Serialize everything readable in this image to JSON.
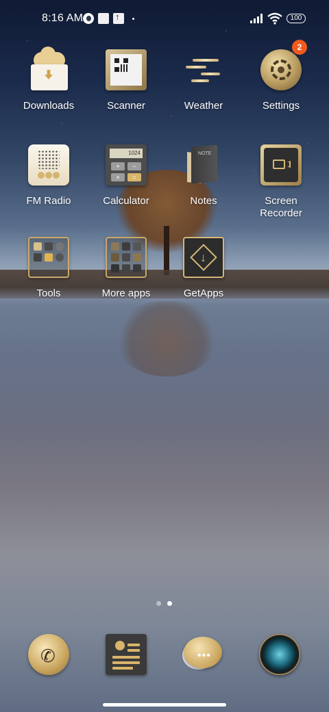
{
  "status_bar": {
    "time": "8:16 AM",
    "battery": "100"
  },
  "apps": {
    "downloads": {
      "label": "Downloads"
    },
    "scanner": {
      "label": "Scanner"
    },
    "weather": {
      "label": "Weather"
    },
    "settings": {
      "label": "Settings",
      "badge": "2"
    },
    "fm_radio": {
      "label": "FM Radio"
    },
    "calculator": {
      "label": "Calculator",
      "display": "1024"
    },
    "notes": {
      "label": "Notes",
      "cover_text": "NOTE"
    },
    "screen_recorder": {
      "label": "Screen Recorder"
    },
    "tools": {
      "label": "Tools"
    },
    "more_apps": {
      "label": "More apps"
    },
    "getapps": {
      "label": "GetApps"
    }
  },
  "page_indicator": {
    "pages": 2,
    "active": 2
  },
  "dock": [
    "phone",
    "contacts",
    "messaging",
    "camera"
  ],
  "colors": {
    "accent_gold": "#d6b978",
    "badge": "#f25a1d"
  }
}
